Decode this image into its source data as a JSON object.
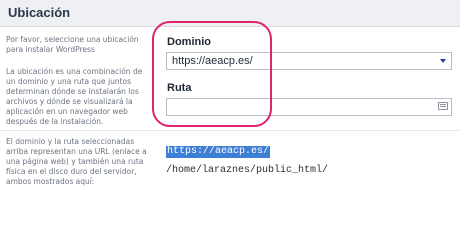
{
  "header": {
    "title": "Ubicación"
  },
  "help": {
    "intro": "Por favor, seleccione una ubicación para instalar WordPress",
    "location_explain": "La ubicación es una combinación de un dominio y una ruta que juntos determinan dónde se instalarán los archivos y dónde se visualizará la aplicación en un navegador web después de la instalación.",
    "url_explain": "El dominio y la ruta seleccionadas arriba representan una URL (enlace a una página web) y también una ruta física en el disco duro del servidor, ambos mostrados aquí:"
  },
  "domain": {
    "label": "Dominio",
    "selected": "https://aeacp.es/"
  },
  "path": {
    "label": "Ruta",
    "value": ""
  },
  "result": {
    "url": "https://aeacp.es/",
    "server_path": "/home/laraznes/public_html/"
  },
  "colors": {
    "highlight_circle": "#e0236f",
    "selection": "#3d7fd6",
    "accent": "#2b3b9b"
  }
}
